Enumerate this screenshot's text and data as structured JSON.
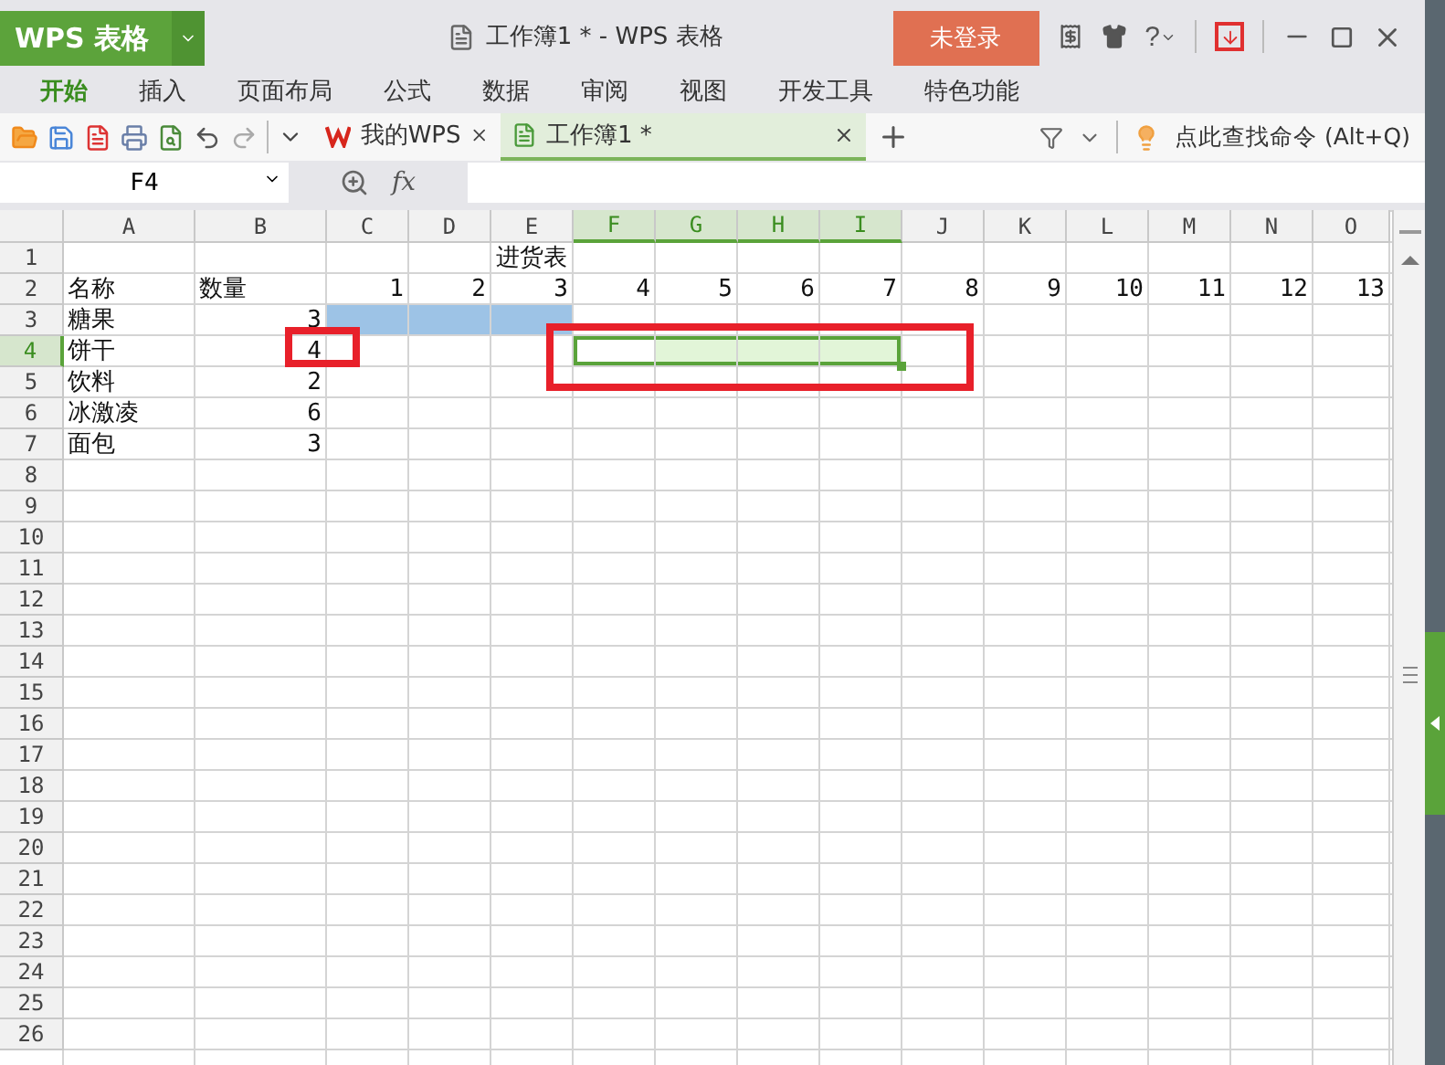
{
  "title_bar": {
    "app_button": "WPS 表格",
    "document_title": "工作簿1 * - WPS 表格",
    "login_button": "未登录",
    "help": "?"
  },
  "menu_tabs": [
    {
      "label": "开始",
      "selected": true
    },
    {
      "label": "插入",
      "selected": false
    },
    {
      "label": "页面布局",
      "selected": false
    },
    {
      "label": "公式",
      "selected": false
    },
    {
      "label": "数据",
      "selected": false
    },
    {
      "label": "审阅",
      "selected": false
    },
    {
      "label": "视图",
      "selected": false
    },
    {
      "label": "开发工具",
      "selected": false
    },
    {
      "label": "特色功能",
      "selected": false
    }
  ],
  "doc_tabs": [
    {
      "label": "我的WPS",
      "kind": "home",
      "selected": false
    },
    {
      "label": "工作簿1 *",
      "kind": "sheet",
      "selected": true
    }
  ],
  "command_search": {
    "placeholder": "点此查找命令 (Alt+Q)"
  },
  "formula_bar": {
    "name_box": "F4",
    "fx": "fx"
  },
  "sheet": {
    "columns": [
      {
        "label": "A",
        "selected": false
      },
      {
        "label": "B",
        "selected": false
      },
      {
        "label": "C",
        "selected": false
      },
      {
        "label": "D",
        "selected": false
      },
      {
        "label": "E",
        "selected": false
      },
      {
        "label": "F",
        "selected": true
      },
      {
        "label": "G",
        "selected": true
      },
      {
        "label": "H",
        "selected": true
      },
      {
        "label": "I",
        "selected": true
      },
      {
        "label": "J",
        "selected": false
      },
      {
        "label": "K",
        "selected": false
      },
      {
        "label": "L",
        "selected": false
      },
      {
        "label": "M",
        "selected": false
      },
      {
        "label": "N",
        "selected": false
      },
      {
        "label": "O",
        "selected": false
      }
    ],
    "rows": [
      {
        "label": "1",
        "selected": false,
        "cells": [
          {},
          {},
          {},
          {},
          {
            "text": "进货表",
            "kind": "title"
          },
          {},
          {},
          {},
          {},
          {},
          {},
          {},
          {},
          {},
          {}
        ]
      },
      {
        "label": "2",
        "selected": false,
        "cells": [
          {
            "text": "名称",
            "kind": "text"
          },
          {
            "text": "数量",
            "kind": "text"
          },
          {
            "text": "1",
            "kind": "number"
          },
          {
            "text": "2",
            "kind": "number"
          },
          {
            "text": "3",
            "kind": "number"
          },
          {
            "text": "4",
            "kind": "number"
          },
          {
            "text": "5",
            "kind": "number"
          },
          {
            "text": "6",
            "kind": "number"
          },
          {
            "text": "7",
            "kind": "number"
          },
          {
            "text": "8",
            "kind": "number"
          },
          {
            "text": "9",
            "kind": "number"
          },
          {
            "text": "10",
            "kind": "number"
          },
          {
            "text": "11",
            "kind": "number"
          },
          {
            "text": "12",
            "kind": "number"
          },
          {
            "text": "13",
            "kind": "number"
          }
        ]
      },
      {
        "label": "3",
        "selected": false,
        "cells": [
          {
            "text": "糖果",
            "kind": "text"
          },
          {
            "text": "3",
            "kind": "number"
          },
          {
            "color": "#9dc3e6"
          },
          {
            "color": "#9dc3e6"
          },
          {
            "color": "#9dc3e6"
          },
          {},
          {},
          {},
          {},
          {},
          {},
          {},
          {},
          {},
          {}
        ]
      },
      {
        "label": "4",
        "selected": true,
        "cells": [
          {
            "text": "饼干",
            "kind": "text"
          },
          {
            "text": "4",
            "kind": "number"
          },
          {},
          {},
          {},
          {
            "selected": true,
            "active": true
          },
          {
            "selected": true,
            "active": false
          },
          {
            "selected": true,
            "active": false
          },
          {
            "selected": true,
            "active": false
          },
          {},
          {},
          {},
          {},
          {},
          {}
        ]
      },
      {
        "label": "5",
        "selected": false,
        "cells": [
          {
            "text": "饮料",
            "kind": "text"
          },
          {
            "text": "2",
            "kind": "number"
          },
          {},
          {},
          {},
          {},
          {},
          {},
          {},
          {},
          {},
          {},
          {},
          {},
          {}
        ]
      },
      {
        "label": "6",
        "selected": false,
        "cells": [
          {
            "text": "冰激凌",
            "kind": "text"
          },
          {
            "text": "6",
            "kind": "number"
          },
          {},
          {},
          {},
          {},
          {},
          {},
          {},
          {},
          {},
          {},
          {},
          {},
          {}
        ]
      },
      {
        "label": "7",
        "selected": false,
        "cells": [
          {
            "text": "面包",
            "kind": "text"
          },
          {
            "text": "3",
            "kind": "number"
          },
          {},
          {},
          {},
          {},
          {},
          {},
          {},
          {},
          {},
          {},
          {},
          {},
          {}
        ]
      },
      {
        "label": "8",
        "selected": false
      },
      {
        "label": "9",
        "selected": false
      },
      {
        "label": "10",
        "selected": false
      },
      {
        "label": "11",
        "selected": false
      },
      {
        "label": "12",
        "selected": false
      },
      {
        "label": "13",
        "selected": false
      },
      {
        "label": "14",
        "selected": false
      },
      {
        "label": "15",
        "selected": false
      },
      {
        "label": "16",
        "selected": false
      },
      {
        "label": "17",
        "selected": false
      },
      {
        "label": "18",
        "selected": false
      },
      {
        "label": "19",
        "selected": false
      },
      {
        "label": "20",
        "selected": false
      },
      {
        "label": "21",
        "selected": false
      },
      {
        "label": "22",
        "selected": false
      },
      {
        "label": "23",
        "selected": false
      },
      {
        "label": "24",
        "selected": false
      },
      {
        "label": "25",
        "selected": false
      },
      {
        "label": "26",
        "selected": false
      }
    ]
  },
  "annotations": [
    {
      "kind": "rectangle",
      "color": "#e8202a"
    },
    {
      "kind": "rectangle",
      "color": "#e8202a"
    }
  ]
}
